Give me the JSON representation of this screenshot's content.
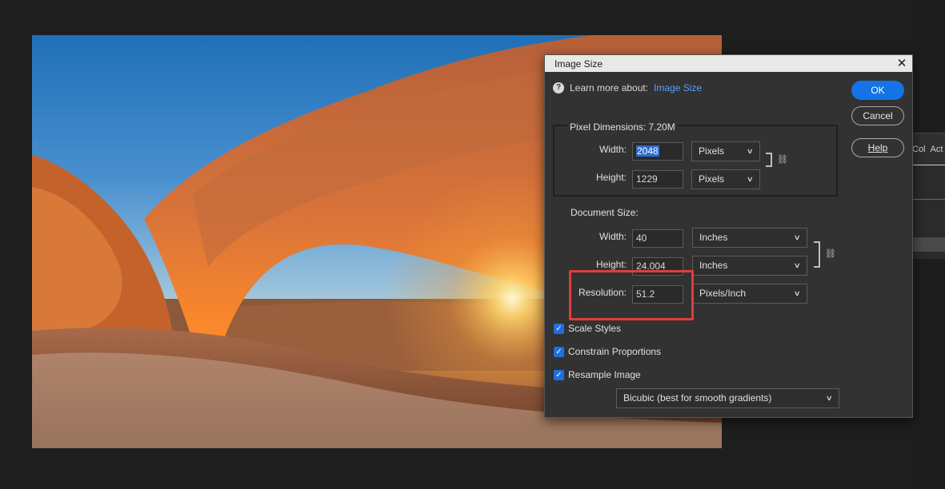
{
  "dialog": {
    "title": "Image Size",
    "learn_more_prefix": "Learn more about:",
    "learn_more_link": "Image Size",
    "buttons": {
      "ok": "OK",
      "cancel": "Cancel",
      "help": "Help"
    },
    "pixel_dimensions": {
      "legend": "Pixel Dimensions:",
      "size": "7.20M",
      "width_label": "Width:",
      "width_value": "2048",
      "width_unit": "Pixels",
      "height_label": "Height:",
      "height_value": "1229",
      "height_unit": "Pixels"
    },
    "document_size": {
      "label": "Document Size:",
      "width_label": "Width:",
      "width_value": "40",
      "width_unit": "Inches",
      "height_label": "Height:",
      "height_value": "24.004",
      "height_unit": "Inches",
      "resolution_label": "Resolution:",
      "resolution_value": "51.2",
      "resolution_unit": "Pixels/Inch"
    },
    "options": {
      "scale_styles": {
        "label": "Scale Styles",
        "checked": true
      },
      "constrain_proportions": {
        "label": "Constrain Proportions",
        "checked": true
      },
      "resample_image": {
        "label": "Resample Image",
        "checked": true
      }
    },
    "resample_method": "Bicubic (best for smooth gradients)"
  },
  "side_panel": {
    "tab_1": "Col",
    "tab_2": "Act"
  },
  "colors": {
    "accent": "#1473e6",
    "highlight": "#e23c3c",
    "link": "#5aa0f5"
  }
}
